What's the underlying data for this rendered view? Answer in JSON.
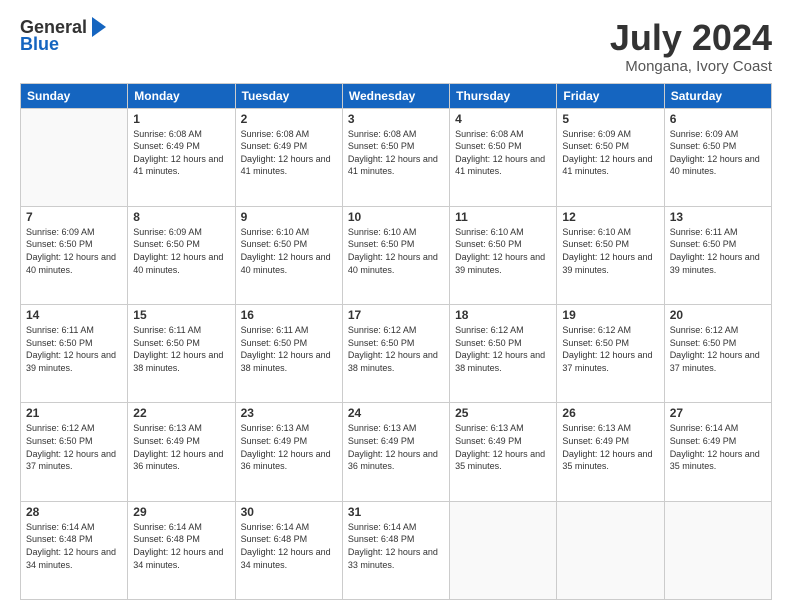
{
  "logo": {
    "general": "General",
    "blue": "Blue"
  },
  "header": {
    "month": "July 2024",
    "location": "Mongana, Ivory Coast"
  },
  "weekdays": [
    "Sunday",
    "Monday",
    "Tuesday",
    "Wednesday",
    "Thursday",
    "Friday",
    "Saturday"
  ],
  "rows": [
    [
      {
        "day": "",
        "empty": true
      },
      {
        "day": "1",
        "sunrise": "6:08 AM",
        "sunset": "6:49 PM",
        "daylight": "12 hours and 41 minutes."
      },
      {
        "day": "2",
        "sunrise": "6:08 AM",
        "sunset": "6:49 PM",
        "daylight": "12 hours and 41 minutes."
      },
      {
        "day": "3",
        "sunrise": "6:08 AM",
        "sunset": "6:50 PM",
        "daylight": "12 hours and 41 minutes."
      },
      {
        "day": "4",
        "sunrise": "6:08 AM",
        "sunset": "6:50 PM",
        "daylight": "12 hours and 41 minutes."
      },
      {
        "day": "5",
        "sunrise": "6:09 AM",
        "sunset": "6:50 PM",
        "daylight": "12 hours and 41 minutes."
      },
      {
        "day": "6",
        "sunrise": "6:09 AM",
        "sunset": "6:50 PM",
        "daylight": "12 hours and 40 minutes."
      }
    ],
    [
      {
        "day": "7",
        "sunrise": "6:09 AM",
        "sunset": "6:50 PM",
        "daylight": "12 hours and 40 minutes."
      },
      {
        "day": "8",
        "sunrise": "6:09 AM",
        "sunset": "6:50 PM",
        "daylight": "12 hours and 40 minutes."
      },
      {
        "day": "9",
        "sunrise": "6:10 AM",
        "sunset": "6:50 PM",
        "daylight": "12 hours and 40 minutes."
      },
      {
        "day": "10",
        "sunrise": "6:10 AM",
        "sunset": "6:50 PM",
        "daylight": "12 hours and 40 minutes."
      },
      {
        "day": "11",
        "sunrise": "6:10 AM",
        "sunset": "6:50 PM",
        "daylight": "12 hours and 39 minutes."
      },
      {
        "day": "12",
        "sunrise": "6:10 AM",
        "sunset": "6:50 PM",
        "daylight": "12 hours and 39 minutes."
      },
      {
        "day": "13",
        "sunrise": "6:11 AM",
        "sunset": "6:50 PM",
        "daylight": "12 hours and 39 minutes."
      }
    ],
    [
      {
        "day": "14",
        "sunrise": "6:11 AM",
        "sunset": "6:50 PM",
        "daylight": "12 hours and 39 minutes."
      },
      {
        "day": "15",
        "sunrise": "6:11 AM",
        "sunset": "6:50 PM",
        "daylight": "12 hours and 38 minutes."
      },
      {
        "day": "16",
        "sunrise": "6:11 AM",
        "sunset": "6:50 PM",
        "daylight": "12 hours and 38 minutes."
      },
      {
        "day": "17",
        "sunrise": "6:12 AM",
        "sunset": "6:50 PM",
        "daylight": "12 hours and 38 minutes."
      },
      {
        "day": "18",
        "sunrise": "6:12 AM",
        "sunset": "6:50 PM",
        "daylight": "12 hours and 38 minutes."
      },
      {
        "day": "19",
        "sunrise": "6:12 AM",
        "sunset": "6:50 PM",
        "daylight": "12 hours and 37 minutes."
      },
      {
        "day": "20",
        "sunrise": "6:12 AM",
        "sunset": "6:50 PM",
        "daylight": "12 hours and 37 minutes."
      }
    ],
    [
      {
        "day": "21",
        "sunrise": "6:12 AM",
        "sunset": "6:50 PM",
        "daylight": "12 hours and 37 minutes."
      },
      {
        "day": "22",
        "sunrise": "6:13 AM",
        "sunset": "6:49 PM",
        "daylight": "12 hours and 36 minutes."
      },
      {
        "day": "23",
        "sunrise": "6:13 AM",
        "sunset": "6:49 PM",
        "daylight": "12 hours and 36 minutes."
      },
      {
        "day": "24",
        "sunrise": "6:13 AM",
        "sunset": "6:49 PM",
        "daylight": "12 hours and 36 minutes."
      },
      {
        "day": "25",
        "sunrise": "6:13 AM",
        "sunset": "6:49 PM",
        "daylight": "12 hours and 35 minutes."
      },
      {
        "day": "26",
        "sunrise": "6:13 AM",
        "sunset": "6:49 PM",
        "daylight": "12 hours and 35 minutes."
      },
      {
        "day": "27",
        "sunrise": "6:14 AM",
        "sunset": "6:49 PM",
        "daylight": "12 hours and 35 minutes."
      }
    ],
    [
      {
        "day": "28",
        "sunrise": "6:14 AM",
        "sunset": "6:48 PM",
        "daylight": "12 hours and 34 minutes."
      },
      {
        "day": "29",
        "sunrise": "6:14 AM",
        "sunset": "6:48 PM",
        "daylight": "12 hours and 34 minutes."
      },
      {
        "day": "30",
        "sunrise": "6:14 AM",
        "sunset": "6:48 PM",
        "daylight": "12 hours and 34 minutes."
      },
      {
        "day": "31",
        "sunrise": "6:14 AM",
        "sunset": "6:48 PM",
        "daylight": "12 hours and 33 minutes."
      },
      {
        "day": "",
        "empty": true
      },
      {
        "day": "",
        "empty": true
      },
      {
        "day": "",
        "empty": true
      }
    ]
  ]
}
